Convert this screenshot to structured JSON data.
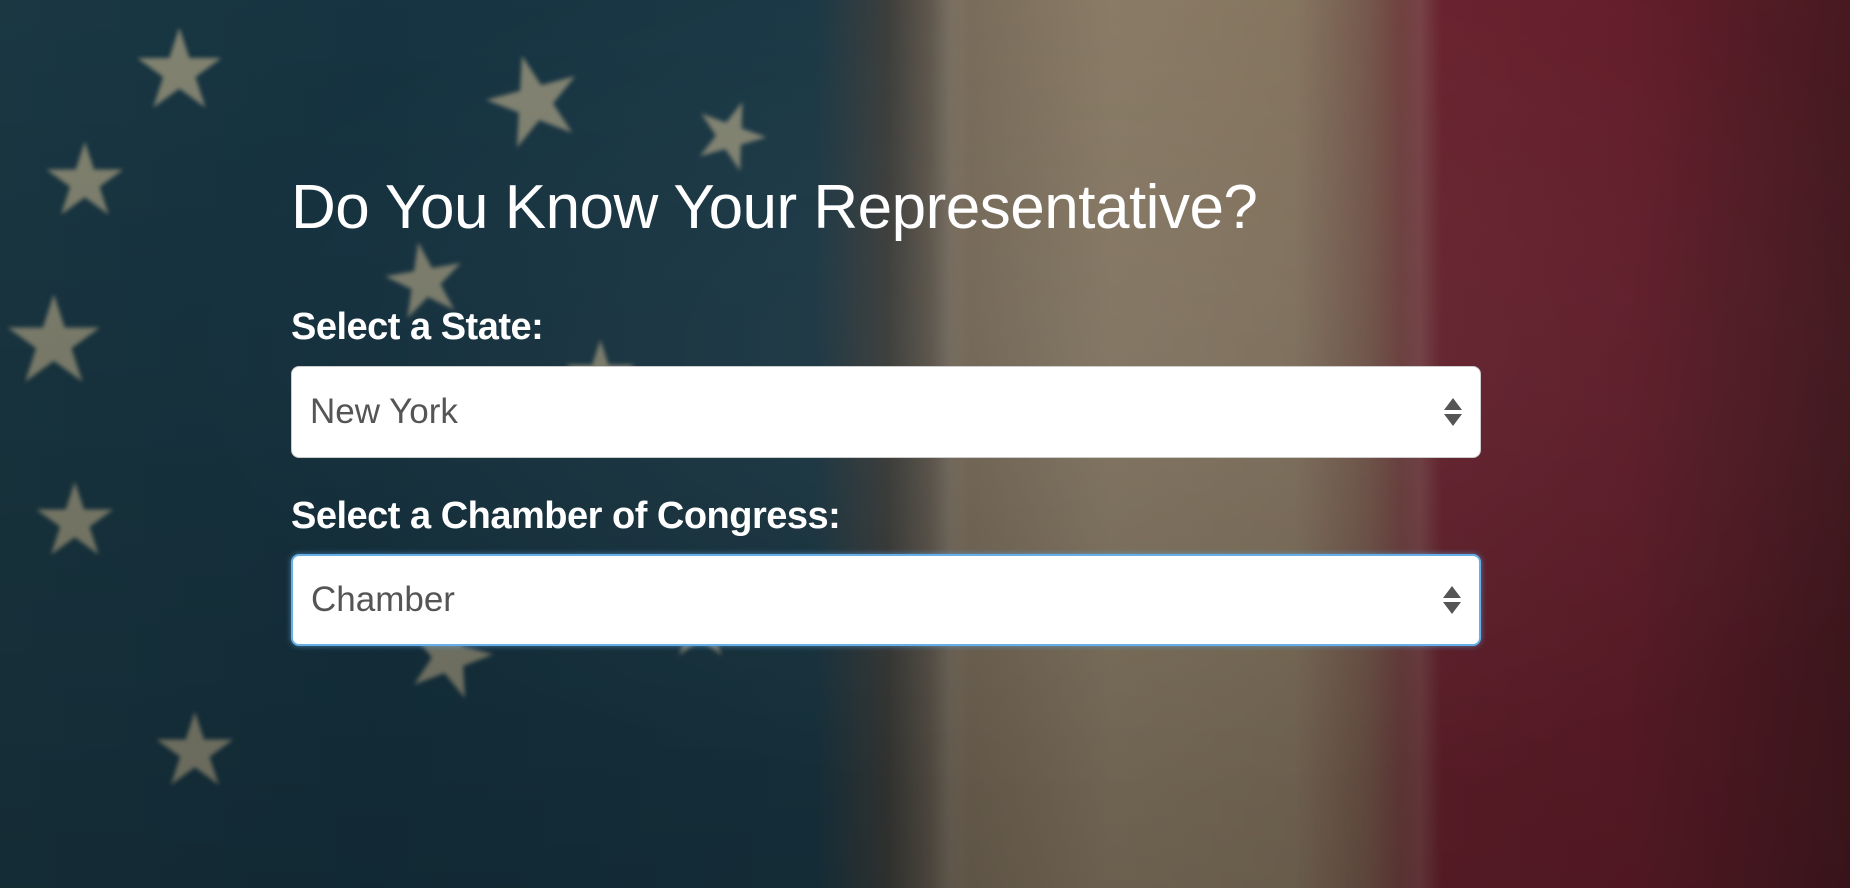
{
  "page": {
    "title": "Do You Know Your Representative?"
  },
  "form": {
    "state_label": "Select a State:",
    "state_selected": "New York",
    "chamber_label": "Select a Chamber of Congress:",
    "chamber_selected": "Chamber"
  },
  "background": {
    "description_icon": "american-flag-background",
    "colors": {
      "blue": "#173645",
      "white": "#8f8069",
      "red": "#6a1f2d"
    }
  },
  "theme": {
    "focus_border": "#66afe9",
    "text_light": "#ffffff",
    "select_text": "#555555"
  }
}
